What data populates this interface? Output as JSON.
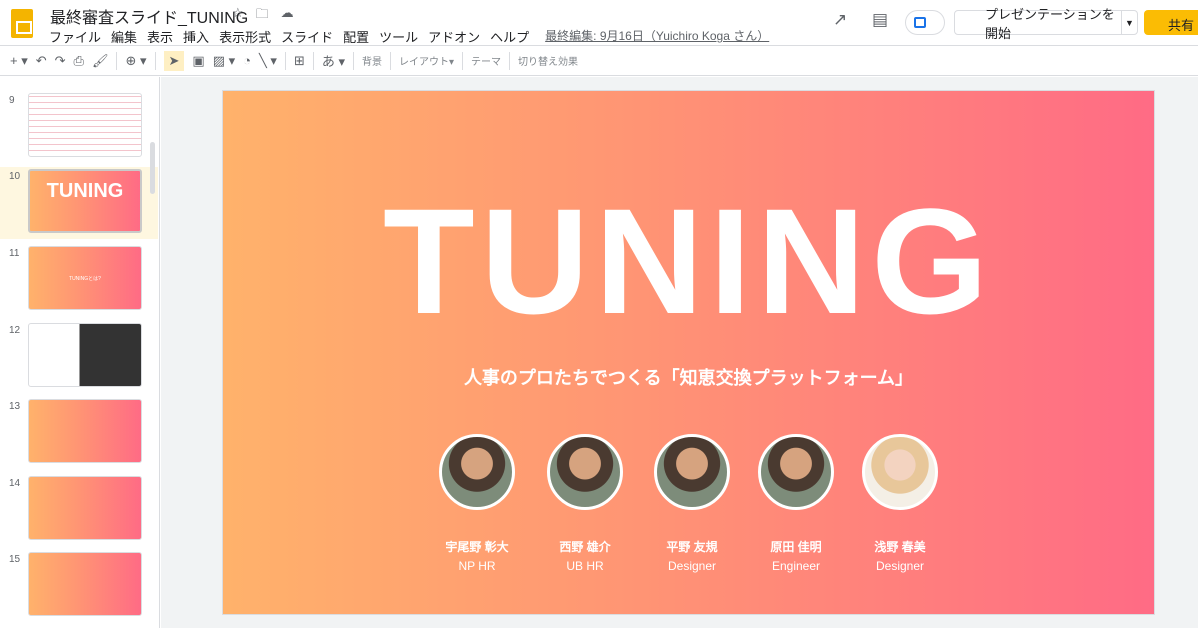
{
  "header": {
    "title": "最終審査スライド_TUNING",
    "menu": [
      "ファイル",
      "編集",
      "表示",
      "挿入",
      "表示形式",
      "スライド",
      "配置",
      "ツール",
      "アドオン",
      "ヘルプ"
    ],
    "last_edit": "最終編集: 9月16日（Yuichiro Koga さん）",
    "present": "プレゼンテーションを開始",
    "share": "共有"
  },
  "toolbar": {
    "background": "背景",
    "layout": "レイアウト▾",
    "theme": "テーマ",
    "transition": "切り替え効果"
  },
  "thumbnails": [
    {
      "n": "9"
    },
    {
      "n": "10",
      "text": "TUNING"
    },
    {
      "n": "11",
      "text": "TUNINGとは?"
    },
    {
      "n": "12"
    },
    {
      "n": "13"
    },
    {
      "n": "14"
    },
    {
      "n": "15"
    }
  ],
  "slide": {
    "title": "TUNING",
    "subtitle": "人事のプロたちでつくる「知恵交換プラットフォーム」",
    "members": [
      {
        "name": "宇尾野 彰大",
        "role": "NP HR"
      },
      {
        "name": "西野 雄介",
        "role": "UB HR"
      },
      {
        "name": "平野 友規",
        "role": "Designer"
      },
      {
        "name": "原田 佳明",
        "role": "Engineer"
      },
      {
        "name": "浅野 春美",
        "role": "Designer"
      }
    ]
  }
}
